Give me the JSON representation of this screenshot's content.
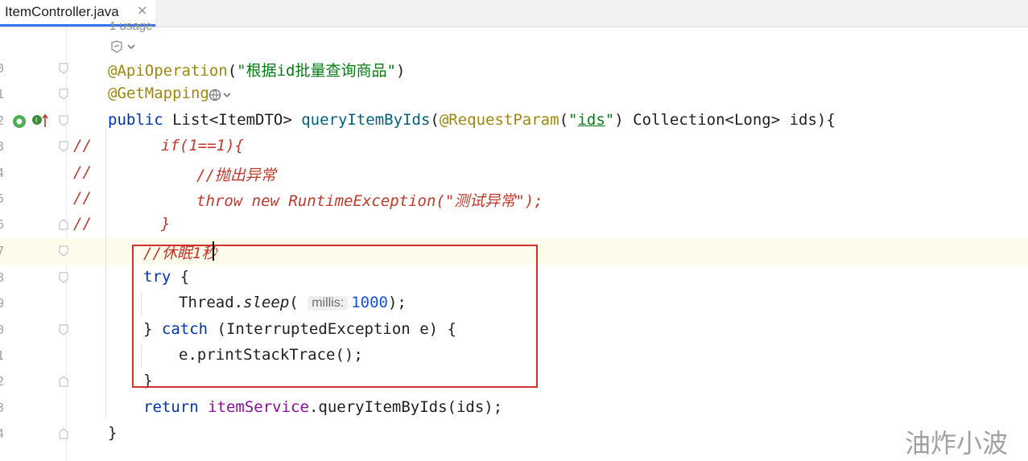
{
  "tab": {
    "title": "ItemController.java",
    "close": "×"
  },
  "usage_hint": "1 usage",
  "line_numbers": [
    "0",
    "1",
    "2",
    "3",
    "4",
    "5",
    "6",
    "7",
    "8",
    "9",
    "0",
    "1",
    "2",
    "3",
    "4"
  ],
  "code": {
    "l1_ann": "@ApiOperation",
    "l1_str": "\"根据id批量查询商品\"",
    "l2_ann": "@GetMapping",
    "l3_public": "public",
    "l3_type": " List<ItemDTO> ",
    "l3_meth": "queryItemByIds",
    "l3_open": "(",
    "l3_ann": "@RequestParam",
    "l3_p1": "(",
    "l3_q1": "\"",
    "l3_ids": "ids",
    "l3_q2": "\"",
    "l3_rest": ") Collection<Long> ids){",
    "l4": "if(1==1){",
    "l5": "//抛出异常",
    "l6": "throw new RuntimeException(\"测试异常\");",
    "l7": "}",
    "comment_marker": "//",
    "l8": "//休眠1秒",
    "l9_kw": "try",
    "l9_rest": " {",
    "l10_cls": "Thread.",
    "l10_meth": "sleep",
    "l10_open": "(",
    "l10_hint": "millis:",
    "l10_num": "1000",
    "l10_close": ");",
    "l11_close": "} ",
    "l11_kw": "catch",
    "l11_rest": " (InterruptedException e) {",
    "l12": "e.printStackTrace();",
    "l13": "}",
    "l14_kw": "return",
    "l14_field": "itemService",
    "l14_rest": ".queryItemByIds(ids);",
    "l15": "}"
  },
  "watermark": "油炸小波",
  "colors": {
    "annotation": "#9e880d",
    "string": "#067d17",
    "keyword": "#0033b3",
    "method": "#00627a",
    "field": "#871094",
    "number": "#1750eb",
    "comment_red": "#c0392b",
    "highlight_box": "#d32f2f",
    "tab_accent": "#3574f0"
  }
}
